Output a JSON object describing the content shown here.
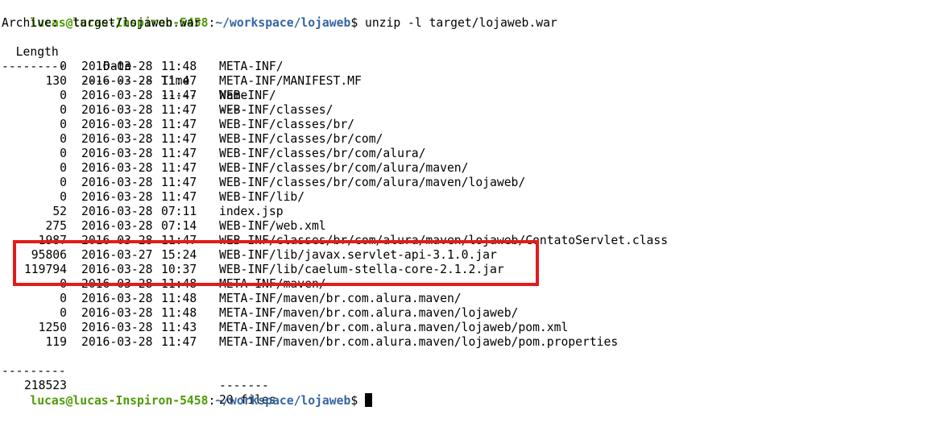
{
  "terminal": {
    "prompt_user_host": "lucas@lucas-Inspiron-5458",
    "prompt_colon": ":",
    "prompt_path": "~/workspace/lojaweb",
    "prompt_dollar": "$",
    "command": " unzip -l target/lojaweb.war",
    "archive_line": "Archive:  target/lojaweb.war",
    "headers": {
      "length": "  Length",
      "date": "Date",
      "time": "Time",
      "name": "Name"
    },
    "header_underline": {
      "length": "---------",
      "date": "----------",
      "time": "-----",
      "name": "----"
    },
    "rows": [
      {
        "length": "0",
        "date": "2016-03-28",
        "time": "11:48",
        "name": "META-INF/"
      },
      {
        "length": "130",
        "date": "2016-03-28",
        "time": "11:47",
        "name": "META-INF/MANIFEST.MF"
      },
      {
        "length": "0",
        "date": "2016-03-28",
        "time": "11:47",
        "name": "WEB-INF/"
      },
      {
        "length": "0",
        "date": "2016-03-28",
        "time": "11:47",
        "name": "WEB-INF/classes/"
      },
      {
        "length": "0",
        "date": "2016-03-28",
        "time": "11:47",
        "name": "WEB-INF/classes/br/"
      },
      {
        "length": "0",
        "date": "2016-03-28",
        "time": "11:47",
        "name": "WEB-INF/classes/br/com/"
      },
      {
        "length": "0",
        "date": "2016-03-28",
        "time": "11:47",
        "name": "WEB-INF/classes/br/com/alura/"
      },
      {
        "length": "0",
        "date": "2016-03-28",
        "time": "11:47",
        "name": "WEB-INF/classes/br/com/alura/maven/"
      },
      {
        "length": "0",
        "date": "2016-03-28",
        "time": "11:47",
        "name": "WEB-INF/classes/br/com/alura/maven/lojaweb/"
      },
      {
        "length": "0",
        "date": "2016-03-28",
        "time": "11:47",
        "name": "WEB-INF/lib/"
      },
      {
        "length": "52",
        "date": "2016-03-28",
        "time": "07:11",
        "name": "index.jsp"
      },
      {
        "length": "275",
        "date": "2016-03-28",
        "time": "07:14",
        "name": "WEB-INF/web.xml"
      },
      {
        "length": "1987",
        "date": "2016-03-28",
        "time": "11:47",
        "name": "WEB-INF/classes/br/com/alura/maven/lojaweb/ContatoServlet.class"
      },
      {
        "length": "95806",
        "date": "2016-03-27",
        "time": "15:24",
        "name": "WEB-INF/lib/javax.servlet-api-3.1.0.jar"
      },
      {
        "length": "119794",
        "date": "2016-03-28",
        "time": "10:37",
        "name": "WEB-INF/lib/caelum-stella-core-2.1.2.jar"
      },
      {
        "length": "0",
        "date": "2016-03-28",
        "time": "11:48",
        "name": "META-INF/maven/"
      },
      {
        "length": "0",
        "date": "2016-03-28",
        "time": "11:48",
        "name": "META-INF/maven/br.com.alura.maven/"
      },
      {
        "length": "0",
        "date": "2016-03-28",
        "time": "11:48",
        "name": "META-INF/maven/br.com.alura.maven/lojaweb/"
      },
      {
        "length": "1250",
        "date": "2016-03-28",
        "time": "11:43",
        "name": "META-INF/maven/br.com.alura.maven/lojaweb/pom.xml"
      },
      {
        "length": "119",
        "date": "2016-03-28",
        "time": "11:47",
        "name": "META-INF/maven/br.com.alura.maven/lojaweb/pom.properties"
      }
    ],
    "footer_underline": {
      "length": "---------",
      "name": "-------"
    },
    "totals": {
      "length": "218523",
      "files": "20 files"
    },
    "colors": {
      "prompt_user": "#4e9a06",
      "prompt_path": "#3465a4",
      "highlight": "#e31b1b"
    }
  }
}
